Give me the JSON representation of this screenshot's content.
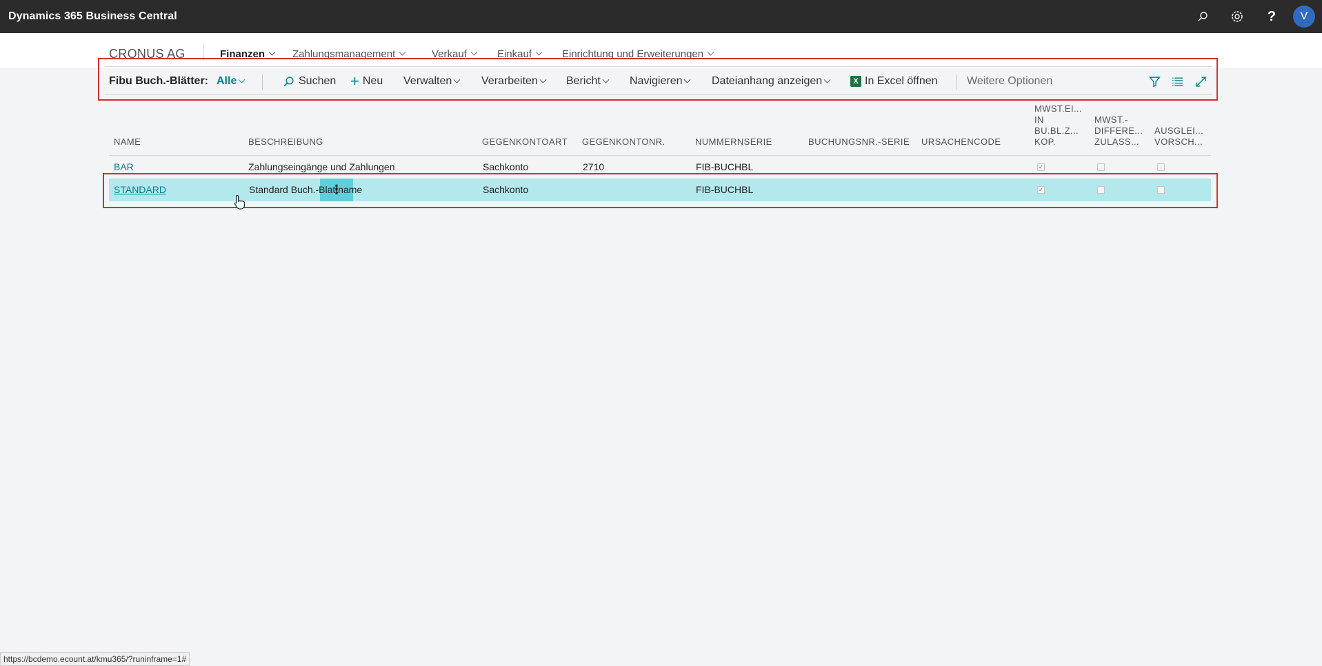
{
  "appbar": {
    "title": "Dynamics 365 Business Central",
    "icons": [
      "search-icon",
      "settings-icon",
      "help-icon"
    ],
    "help_label": "?",
    "avatar_initial": "V"
  },
  "nav": {
    "company": "CRONUS AG",
    "items": [
      {
        "label": "Finanzen",
        "active": true
      },
      {
        "label": "Zahlungsmanagement",
        "active": false
      },
      {
        "label": "Verkauf",
        "active": false
      },
      {
        "label": "Einkauf",
        "active": false
      },
      {
        "label": "Einrichtung und Erweiterungen",
        "active": false
      }
    ]
  },
  "actionbar": {
    "caption": "Fibu Buch.-Blätter:",
    "filter": "Alle",
    "search": "Suchen",
    "new": "Neu",
    "manage": "Verwalten",
    "process": "Verarbeiten",
    "report": "Bericht",
    "navigate": "Navigieren",
    "attachment": "Dateianhang anzeigen",
    "excel_icon": "X",
    "excel": "In Excel öffnen",
    "more": "Weitere Optionen"
  },
  "table": {
    "headers": {
      "name": "NAME",
      "description": "BESCHREIBUNG",
      "bal_type": "GEGENKONTOART",
      "bal_no": "GEGENKONTONR.",
      "no_series": "NUMMERNSERIE",
      "posting_series": "BUCHUNGSNR.-SERIE",
      "reason": "URSACHENCODE",
      "vat_1": "MWST.EI...",
      "vat_2": "IN",
      "vat_3": "BU.BL.Z...",
      "vat_4": "KOP.",
      "diff_1": "MWST.-",
      "diff_2": "DIFFERE...",
      "diff_3": "ZULASS...",
      "appl_1": "AUSGLEI...",
      "appl_2": "VORSCH..."
    },
    "rows": [
      {
        "name": "BAR",
        "description": "Zahlungseingänge und Zahlungen",
        "bal_type": "Sachkonto",
        "bal_no": "2710",
        "no_series": "FIB-BUCHBL",
        "posting_series": "",
        "reason": "",
        "vat_copy": true,
        "vat_diff": false,
        "suggest": false
      },
      {
        "name": "STANDARD",
        "description": "Standard Buch.-Blattname",
        "bal_type": "Sachkonto",
        "bal_no": "",
        "no_series": "FIB-BUCHBL",
        "posting_series": "",
        "reason": "",
        "vat_copy": true,
        "vat_diff": false,
        "suggest": false,
        "row_menu": "⋮"
      }
    ]
  },
  "status_url": "https://bcdemo.ecount.at/kmu365/?runinframe=1#",
  "checkmark": "✓",
  "colors": {
    "accent": "#00838f",
    "selected_row": "#b3e8ec",
    "annotation": "#d32f2f",
    "appbar": "#2b2b2b"
  }
}
